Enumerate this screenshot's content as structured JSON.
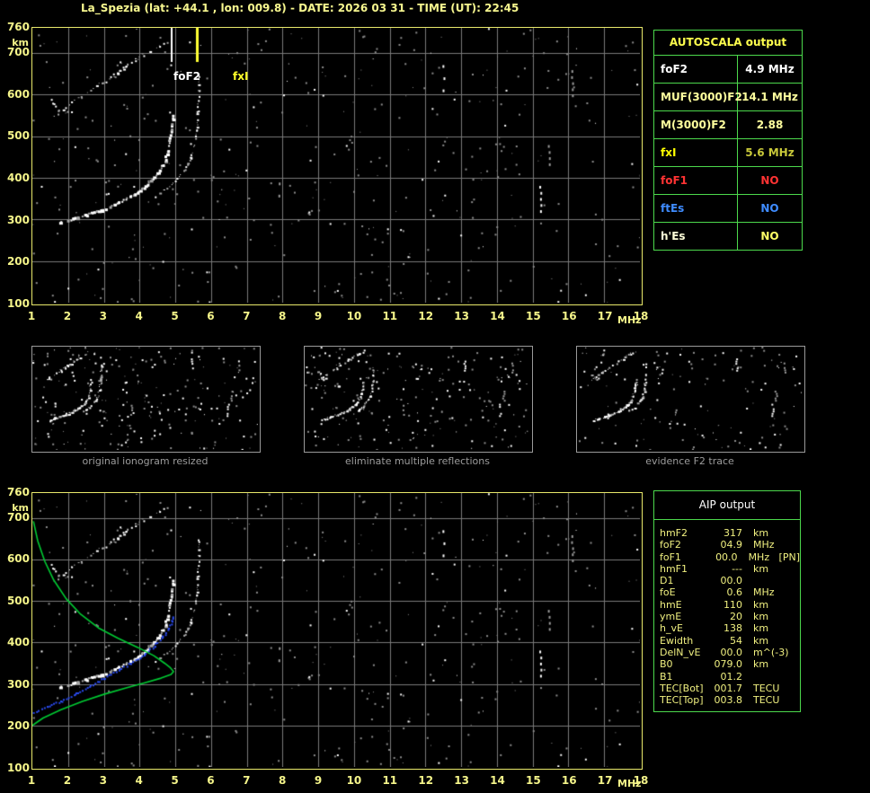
{
  "title": "La_Spezia (lat: +44.1 , lon: 009.8) - DATE: 2026 03 31 - TIME (UT): 22:45",
  "colors": {
    "title_yellow": "#f7f78f",
    "axis_yellow": "#f5f58a",
    "plot_border_yellow": "#e9e96b",
    "table_border_green": "#4cd94c",
    "grid_gray": "#7a7a7a",
    "trace_white": "#ffffff",
    "noise_gray": "#8c8c8c",
    "profile_green": "#00cc33",
    "scaled_trace_blue": "#2a4bf0",
    "alert_red": "#ff3333",
    "alert_blue": "#3f8cff"
  },
  "autoscala": {
    "header": "AUTOSCALA output",
    "rows": [
      {
        "label": "foF2",
        "value": "4.9 MHz"
      },
      {
        "label": "MUF(3000)F2",
        "value": "14.1 MHz"
      },
      {
        "label": "M(3000)F2",
        "value": "2.88"
      },
      {
        "label": "fxI",
        "value": "5.6 MHz"
      },
      {
        "label": "foF1",
        "value": "NO"
      },
      {
        "label": "ftEs",
        "value": "NO"
      },
      {
        "label": "h'Es",
        "value": "NO"
      }
    ]
  },
  "aip": {
    "header": "AIP output",
    "rows": [
      {
        "label": "hmF2",
        "value": "317",
        "unit": "km",
        "note": ""
      },
      {
        "label": "foF2",
        "value": "04.9",
        "unit": "MHz",
        "note": ""
      },
      {
        "label": "foF1",
        "value": "00.0",
        "unit": "MHz",
        "note": "[PN]"
      },
      {
        "label": "hmF1",
        "value": "---",
        "unit": "km",
        "note": ""
      },
      {
        "label": "D1",
        "value": "00.0",
        "unit": "",
        "note": ""
      },
      {
        "label": "foE",
        "value": "0.6",
        "unit": "MHz",
        "note": ""
      },
      {
        "label": "hmE",
        "value": "110",
        "unit": "km",
        "note": ""
      },
      {
        "label": "ymE",
        "value": "20",
        "unit": "km",
        "note": ""
      },
      {
        "label": "h_vE",
        "value": "138",
        "unit": "km",
        "note": ""
      },
      {
        "label": "Ewidth",
        "value": "54",
        "unit": "km",
        "note": ""
      },
      {
        "label": "DelN_vE",
        "value": "00.0",
        "unit": "m^(-3)",
        "note": ""
      },
      {
        "label": "B0",
        "value": "079.0",
        "unit": "km",
        "note": ""
      },
      {
        "label": "B1",
        "value": "01.2",
        "unit": "",
        "note": ""
      },
      {
        "label": "TEC[Bot]",
        "value": "001.7",
        "unit": "TECU",
        "note": ""
      },
      {
        "label": "TEC[Top]",
        "value": "003.8",
        "unit": "TECU",
        "note": ""
      }
    ]
  },
  "thumbnails": [
    {
      "caption": "original ionogram resized"
    },
    {
      "caption": "eliminate multiple reflections"
    },
    {
      "caption": "evidence F2 trace"
    }
  ],
  "chart_data": [
    {
      "id": "ionogram-main",
      "type": "scatter",
      "title": "",
      "xlabel": "MHz",
      "ylabel": "km",
      "xlim": [
        1,
        18
      ],
      "ylim": [
        100,
        760
      ],
      "xticks": [
        1,
        2,
        3,
        4,
        5,
        6,
        7,
        8,
        9,
        10,
        11,
        12,
        13,
        14,
        15,
        16,
        17,
        18
      ],
      "yticks": [
        760,
        700,
        600,
        500,
        400,
        300,
        200,
        100
      ],
      "grid": true,
      "legend": "none",
      "markers": [
        {
          "name": "foF2",
          "f_mhz": 4.9,
          "color": "#ffffff"
        },
        {
          "name": "fxI",
          "f_mhz": 5.6,
          "color": "#ffff33"
        }
      ],
      "traces": {
        "f2_ordinary": [
          [
            1.75,
            293
          ],
          [
            2.1,
            303
          ],
          [
            2.5,
            313
          ],
          [
            2.9,
            324
          ],
          [
            3.3,
            338
          ],
          [
            3.7,
            356
          ],
          [
            4.05,
            375
          ],
          [
            4.35,
            398
          ],
          [
            4.55,
            420
          ],
          [
            4.7,
            447
          ],
          [
            4.8,
            478
          ],
          [
            4.87,
            515
          ],
          [
            4.91,
            550
          ]
        ],
        "f2_extraordinary": [
          [
            4.35,
            352
          ],
          [
            4.75,
            375
          ],
          [
            5.05,
            398
          ],
          [
            5.25,
            420
          ],
          [
            5.42,
            448
          ],
          [
            5.52,
            480
          ],
          [
            5.58,
            515
          ],
          [
            5.62,
            560
          ],
          [
            5.64,
            610
          ],
          [
            5.65,
            650
          ]
        ],
        "second_hop_o": [
          [
            1.6,
            548
          ],
          [
            2.1,
            582
          ],
          [
            2.6,
            612
          ],
          [
            3.1,
            640
          ],
          [
            3.6,
            668
          ],
          [
            4.1,
            695
          ],
          [
            4.55,
            718
          ],
          [
            4.85,
            732
          ]
        ],
        "second_hop_x": [
          [
            2.95,
            625
          ],
          [
            3.35,
            652
          ],
          [
            3.75,
            680
          ],
          [
            4.05,
            700
          ]
        ],
        "cusp_hook": [
          [
            1.5,
            598
          ],
          [
            1.58,
            578
          ],
          [
            1.72,
            564
          ],
          [
            1.9,
            556
          ],
          [
            2.08,
            560
          ]
        ]
      },
      "interference_streaks": [
        {
          "f": 12.5,
          "h": [
            612,
            688
          ],
          "bright": true
        },
        {
          "f": 15.2,
          "h": [
            322,
            396
          ],
          "bright": true
        },
        {
          "f": 15.45,
          "h": [
            420,
            480
          ],
          "bright": false
        },
        {
          "f": 16.1,
          "h": [
            600,
            660
          ],
          "bright": false
        },
        {
          "f": 7.9,
          "h": [
            330,
            400
          ],
          "bright": false
        },
        {
          "f": 5.95,
          "h": [
            103,
            114
          ],
          "bright": true
        }
      ]
    },
    {
      "id": "profile-overlay",
      "type": "line",
      "xlabel": "MHz",
      "ylabel": "km",
      "xlim": [
        1,
        18
      ],
      "ylim": [
        100,
        760
      ],
      "series": [
        {
          "name": "electron_density_profile",
          "color": "#00cc33",
          "points": [
            [
              1.03,
              692
            ],
            [
              1.15,
              645
            ],
            [
              1.35,
              595
            ],
            [
              1.6,
              550
            ],
            [
              1.95,
              505
            ],
            [
              2.35,
              468
            ],
            [
              2.85,
              435
            ],
            [
              3.4,
              410
            ],
            [
              3.95,
              388
            ],
            [
              4.4,
              368
            ],
            [
              4.7,
              350
            ],
            [
              4.85,
              340
            ],
            [
              4.95,
              330
            ],
            [
              4.88,
              323
            ],
            [
              4.6,
              314
            ],
            [
              4.15,
              303
            ],
            [
              3.6,
              290
            ],
            [
              3.0,
              275
            ],
            [
              2.4,
              258
            ],
            [
              1.8,
              238
            ],
            [
              1.3,
              218
            ],
            [
              1.0,
              200
            ]
          ]
        },
        {
          "name": "autoscala_scaled_f2_trace",
          "color": "#2a4bf0",
          "points": [
            [
              1.02,
              232
            ],
            [
              1.4,
              245
            ],
            [
              1.8,
              260
            ],
            [
              2.2,
              278
            ],
            [
              2.6,
              296
            ],
            [
              3.0,
              315
            ],
            [
              3.4,
              335
            ],
            [
              3.75,
              352
            ],
            [
              4.1,
              372
            ],
            [
              4.4,
              393
            ],
            [
              4.65,
              415
            ],
            [
              4.8,
              437
            ],
            [
              4.9,
              452
            ],
            [
              4.93,
              462
            ]
          ]
        }
      ],
      "key_values": {
        "hmF2_km": 317,
        "foF2_MHz": 4.9
      }
    }
  ]
}
